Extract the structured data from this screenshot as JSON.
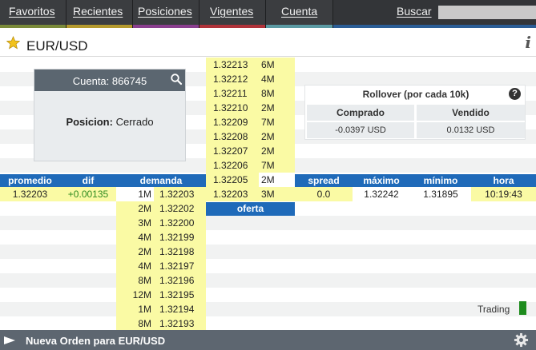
{
  "nav": {
    "tabs": [
      {
        "label": "Favoritos",
        "color": "#7a8a3a"
      },
      {
        "label": "Recientes",
        "color": "#b59a2e"
      },
      {
        "label": "Posiciones",
        "color": "#8a3f8f"
      },
      {
        "label": "Vigentes",
        "color": "#b0333a"
      },
      {
        "label": "Cuenta",
        "color": "#5b9aa3"
      }
    ],
    "search_label": "Buscar",
    "search_placeholder": ""
  },
  "header": {
    "title": "EUR/USD",
    "info_icon": "i"
  },
  "account": {
    "title": "Cuenta: 866745",
    "position_label": "Posicion:",
    "position_value": "Cerrado"
  },
  "rollover": {
    "title": "Rollover (por cada 10k)",
    "bought_label": "Comprado",
    "sold_label": "Vendido",
    "bought_value": "-0.0397 USD",
    "sold_value": "0.0132 USD"
  },
  "offer": {
    "label": "oferta",
    "rows": [
      {
        "price": "1.32213",
        "size": "6M"
      },
      {
        "price": "1.32212",
        "size": "4M"
      },
      {
        "price": "1.32211",
        "size": "8M"
      },
      {
        "price": "1.32210",
        "size": "2M"
      },
      {
        "price": "1.32209",
        "size": "7M"
      },
      {
        "price": "1.32208",
        "size": "2M"
      },
      {
        "price": "1.32207",
        "size": "2M"
      },
      {
        "price": "1.32206",
        "size": "7M"
      },
      {
        "price": "1.32205",
        "size": "2M"
      },
      {
        "price": "1.32203",
        "size": "3M"
      }
    ]
  },
  "demand": {
    "label": "demanda",
    "rows": [
      {
        "size": "1M",
        "price": "1.32203"
      },
      {
        "size": "2M",
        "price": "1.32202"
      },
      {
        "size": "3M",
        "price": "1.32200"
      },
      {
        "size": "4M",
        "price": "1.32199"
      },
      {
        "size": "2M",
        "price": "1.32198"
      },
      {
        "size": "4M",
        "price": "1.32197"
      },
      {
        "size": "8M",
        "price": "1.32196"
      },
      {
        "size": "12M",
        "price": "1.32195"
      },
      {
        "size": "1M",
        "price": "1.32194"
      },
      {
        "size": "8M",
        "price": "1.32193"
      }
    ]
  },
  "stats": {
    "average_label": "promedio",
    "average": "1.32203",
    "diff_label": "dif",
    "diff": "+0.00135",
    "spread_label": "spread",
    "spread": "0.0",
    "max_label": "máximo",
    "max": "1.32242",
    "min_label": "mínimo",
    "min": "1.31895",
    "time_label": "hora",
    "time": "10:19:43"
  },
  "status": {
    "label": "Trading",
    "color": "#1e8c1e"
  },
  "footer": {
    "label": "Nueva Orden para EUR/USD"
  },
  "colors": {
    "accent": "#1f6ab9",
    "highlight": "#fafaa4",
    "positive": "#2e8b1f"
  }
}
